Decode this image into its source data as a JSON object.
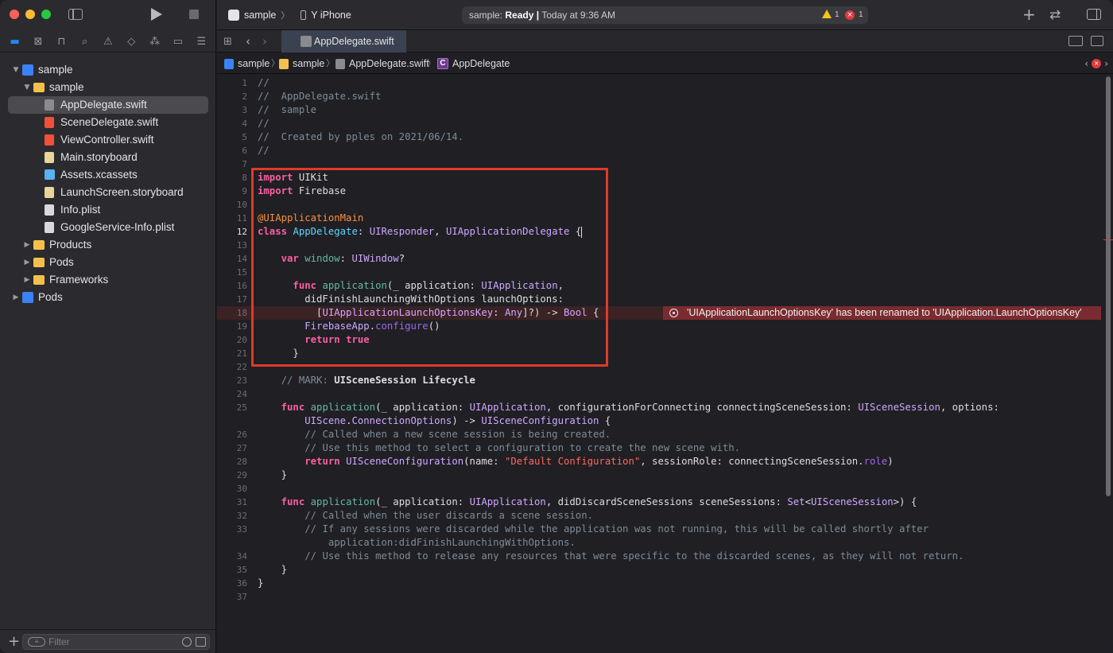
{
  "window": {
    "title": "sample"
  },
  "toolbar": {
    "scheme_name": "sample",
    "device_name": "Y iPhone",
    "status_project": "sample:",
    "status_state": "Ready",
    "status_sep": "|",
    "status_time": "Today at 9:36 AM",
    "warning_count": "1",
    "error_count": "1"
  },
  "navigator": {
    "tabs": [
      "folder-icon",
      "x-square-icon",
      "hierarchy-icon",
      "search-icon",
      "warning-icon",
      "diamond-icon",
      "spray-icon",
      "tag-icon",
      "report-icon"
    ],
    "tree": [
      {
        "label": "sample",
        "kind": "project",
        "depth": 0,
        "disclosure": "▼"
      },
      {
        "label": "sample",
        "kind": "folder",
        "depth": 1,
        "disclosure": "▼"
      },
      {
        "label": "AppDelegate.swift",
        "kind": "swift",
        "depth": 2,
        "selected": true
      },
      {
        "label": "SceneDelegate.swift",
        "kind": "swift",
        "depth": 2
      },
      {
        "label": "ViewController.swift",
        "kind": "swift",
        "depth": 2
      },
      {
        "label": "Main.storyboard",
        "kind": "storyboard",
        "depth": 2
      },
      {
        "label": "Assets.xcassets",
        "kind": "assets",
        "depth": 2
      },
      {
        "label": "LaunchScreen.storyboard",
        "kind": "storyboard",
        "depth": 2
      },
      {
        "label": "Info.plist",
        "kind": "plist",
        "depth": 2
      },
      {
        "label": "GoogleService-Info.plist",
        "kind": "plist",
        "depth": 2
      },
      {
        "label": "Products",
        "kind": "folder",
        "depth": 1,
        "disclosure": "▶"
      },
      {
        "label": "Pods",
        "kind": "folder",
        "depth": 1,
        "disclosure": "▶"
      },
      {
        "label": "Frameworks",
        "kind": "folder",
        "depth": 1,
        "disclosure": "▶"
      },
      {
        "label": "Pods",
        "kind": "project",
        "depth": 0,
        "disclosure": "▶"
      }
    ],
    "filter_placeholder": "Filter"
  },
  "tabbar": {
    "active_tab": "AppDelegate.swift"
  },
  "jumpbar": {
    "crumbs": [
      "sample",
      "sample",
      "AppDelegate.swift",
      "AppDelegate"
    ],
    "class_badge": "C"
  },
  "editor": {
    "current_line": 12,
    "error_line": 18,
    "error_message": "'UIApplicationLaunchOptionsKey' has been renamed to 'UIApplication.LaunchOptionsKey'",
    "lines": [
      {
        "n": "1",
        "html": "<span class='cm'>//</span>"
      },
      {
        "n": "2",
        "html": "<span class='cm'>//  AppDelegate.swift</span>"
      },
      {
        "n": "3",
        "html": "<span class='cm'>//  sample</span>"
      },
      {
        "n": "4",
        "html": "<span class='cm'>//</span>"
      },
      {
        "n": "5",
        "html": "<span class='cm'>//  Created by pples on 2021/06/14.</span>"
      },
      {
        "n": "6",
        "html": "<span class='cm'>//</span>"
      },
      {
        "n": "7",
        "html": ""
      },
      {
        "n": "8",
        "html": "<span class='kw'>import</span> UIKit"
      },
      {
        "n": "9",
        "html": "<span class='kw'>import</span> Firebase"
      },
      {
        "n": "10",
        "html": ""
      },
      {
        "n": "11",
        "html": "<span class='attr'>@UIApplicationMain</span>"
      },
      {
        "n": "12",
        "html": "<span class='kw'>class</span> <span class='tyd'>AppDelegate</span>: <span class='ty'>UIResponder</span>, <span class='ty'>UIApplicationDelegate</span> {<span class='caret'></span>"
      },
      {
        "n": "13",
        "html": ""
      },
      {
        "n": "14",
        "html": "    <span class='kw'>var</span> <span class='fn'>window</span>: <span class='ty'>UIWindow</span>?"
      },
      {
        "n": "15",
        "html": ""
      },
      {
        "n": "16",
        "html": "      <span class='kw'>func</span> <span class='fn'>application</span>(_ application: <span class='ty'>UIApplication</span>,"
      },
      {
        "n": "17",
        "html": "        didFinishLaunchingWithOptions launchOptions:"
      },
      {
        "n": "18",
        "html": "          [<span class='ty'>UIApplicationLaunchOptionsKey</span>: <span class='ty'>Any</span>]?) -> <span class='ty'>Bool</span> {"
      },
      {
        "n": "19",
        "html": "        <span class='ty'>FirebaseApp</span>.<span class='fnx'>configure</span>()"
      },
      {
        "n": "20",
        "html": "        <span class='kw'>return</span> <span class='kw'>true</span>"
      },
      {
        "n": "21",
        "html": "      }"
      },
      {
        "n": "22",
        "html": ""
      },
      {
        "n": "23",
        "html": "    <span class='cm'>// MARK: </span><span class='b'>UISceneSession Lifecycle</span>"
      },
      {
        "n": "24",
        "html": ""
      },
      {
        "n": "25",
        "html": "    <span class='kw'>func</span> <span class='fn'>application</span>(_ application: <span class='ty'>UIApplication</span>, configurationForConnecting connectingSceneSession: <span class='ty'>UISceneSession</span>, options:"
      },
      {
        "n": "",
        "html": "        <span class='ty'>UIScene</span>.<span class='ty'>ConnectionOptions</span>) -> <span class='ty'>UISceneConfiguration</span> {"
      },
      {
        "n": "26",
        "html": "        <span class='cm'>// Called when a new scene session is being created.</span>"
      },
      {
        "n": "27",
        "html": "        <span class='cm'>// Use this method to select a configuration to create the new scene with.</span>"
      },
      {
        "n": "28",
        "html": "        <span class='kw'>return</span> <span class='ty'>UISceneConfiguration</span>(name: <span class='str'>\"Default Configuration\"</span>, sessionRole: connectingSceneSession.<span class='fnx'>role</span>)"
      },
      {
        "n": "29",
        "html": "    }"
      },
      {
        "n": "30",
        "html": ""
      },
      {
        "n": "31",
        "html": "    <span class='kw'>func</span> <span class='fn'>application</span>(_ application: <span class='ty'>UIApplication</span>, didDiscardSceneSessions sceneSessions: <span class='ty'>Set</span>&lt;<span class='ty'>UISceneSession</span>&gt;) {"
      },
      {
        "n": "32",
        "html": "        <span class='cm'>// Called when the user discards a scene session.</span>"
      },
      {
        "n": "33",
        "html": "        <span class='cm'>// If any sessions were discarded while the application was not running, this will be called shortly after</span>"
      },
      {
        "n": "",
        "html": "            <span class='cm'>application:didFinishLaunchingWithOptions.</span>"
      },
      {
        "n": "34",
        "html": "        <span class='cm'>// Use this method to release any resources that were specific to the discarded scenes, as they will not return.</span>"
      },
      {
        "n": "35",
        "html": "    }"
      },
      {
        "n": "36",
        "html": "}"
      },
      {
        "n": "37",
        "html": ""
      }
    ]
  }
}
